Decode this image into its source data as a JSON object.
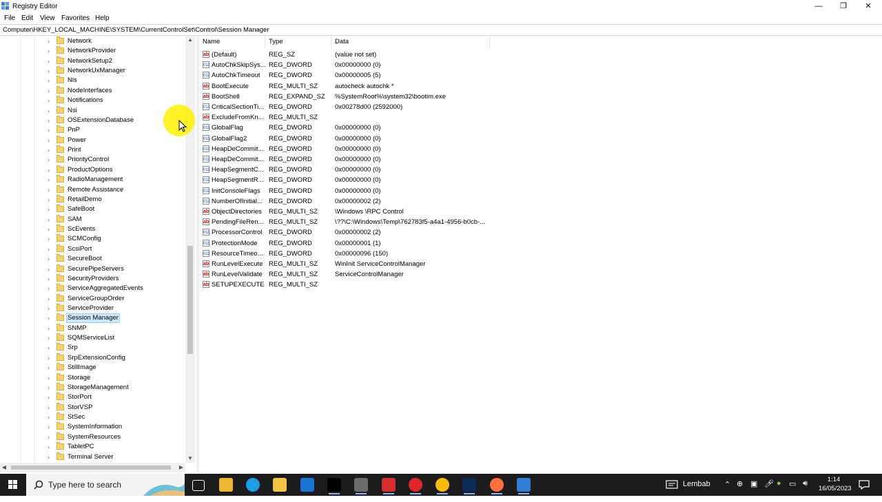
{
  "window": {
    "title": "Registry Editor",
    "controls": {
      "minimize": "—",
      "maximize": "❐",
      "close": "✕"
    }
  },
  "menu": [
    "File",
    "Edit",
    "View",
    "Favorites",
    "Help"
  ],
  "address": "Computer\\HKEY_LOCAL_MACHINE\\SYSTEM\\CurrentControlSet\\Control\\Session Manager",
  "tree": {
    "selected": "Session Manager",
    "items": [
      "Network",
      "NetworkProvider",
      "NetworkSetup2",
      "NetworkUxManager",
      "Nls",
      "NodeInterfaces",
      "Notifications",
      "Nsi",
      "OSExtensionDatabase",
      "PnP",
      "Power",
      "Print",
      "PriorityControl",
      "ProductOptions",
      "RadioManagement",
      "Remote Assistance",
      "RetailDemo",
      "SafeBoot",
      "SAM",
      "ScEvents",
      "SCMConfig",
      "ScsiPort",
      "SecureBoot",
      "SecurePipeServers",
      "SecurityProviders",
      "ServiceAggregatedEvents",
      "ServiceGroupOrder",
      "ServiceProvider",
      "Session Manager",
      "SNMP",
      "SQMServiceList",
      "Srp",
      "SrpExtensionConfig",
      "StillImage",
      "Storage",
      "StorageManagement",
      "StorPort",
      "StorVSP",
      "StSec",
      "SystemInformation",
      "SystemResources",
      "TabletPC",
      "Terminal Server"
    ]
  },
  "list": {
    "columns": [
      "Name",
      "Type",
      "Data"
    ],
    "rows": [
      {
        "icon": "string-value-icon",
        "name": "(Default)",
        "type": "REG_SZ",
        "data": "(value not set)"
      },
      {
        "icon": "binary-value-icon",
        "name": "AutoChkSkipSys...",
        "type": "REG_DWORD",
        "data": "0x00000000 (0)"
      },
      {
        "icon": "binary-value-icon",
        "name": "AutoChkTimeout",
        "type": "REG_DWORD",
        "data": "0x00000005 (5)"
      },
      {
        "icon": "string-value-icon",
        "name": "BootExecute",
        "type": "REG_MULTI_SZ",
        "data": "autocheck autochk *"
      },
      {
        "icon": "string-value-icon",
        "name": "BootShell",
        "type": "REG_EXPAND_SZ",
        "data": "%SystemRoot%\\system32\\bootim.exe"
      },
      {
        "icon": "binary-value-icon",
        "name": "CriticalSectionTi...",
        "type": "REG_DWORD",
        "data": "0x00278d00 (2592000)"
      },
      {
        "icon": "string-value-icon",
        "name": "ExcludeFromKn...",
        "type": "REG_MULTI_SZ",
        "data": ""
      },
      {
        "icon": "binary-value-icon",
        "name": "GlobalFlag",
        "type": "REG_DWORD",
        "data": "0x00000000 (0)"
      },
      {
        "icon": "binary-value-icon",
        "name": "GlobalFlag2",
        "type": "REG_DWORD",
        "data": "0x00000000 (0)"
      },
      {
        "icon": "binary-value-icon",
        "name": "HeapDeCommit...",
        "type": "REG_DWORD",
        "data": "0x00000000 (0)"
      },
      {
        "icon": "binary-value-icon",
        "name": "HeapDeCommit...",
        "type": "REG_DWORD",
        "data": "0x00000000 (0)"
      },
      {
        "icon": "binary-value-icon",
        "name": "HeapSegmentC...",
        "type": "REG_DWORD",
        "data": "0x00000000 (0)"
      },
      {
        "icon": "binary-value-icon",
        "name": "HeapSegmentR...",
        "type": "REG_DWORD",
        "data": "0x00000000 (0)"
      },
      {
        "icon": "binary-value-icon",
        "name": "InitConsoleFlags",
        "type": "REG_DWORD",
        "data": "0x00000000 (0)"
      },
      {
        "icon": "binary-value-icon",
        "name": "NumberOfInitial...",
        "type": "REG_DWORD",
        "data": "0x00000002 (2)"
      },
      {
        "icon": "string-value-icon",
        "name": "ObjectDirectories",
        "type": "REG_MULTI_SZ",
        "data": "\\Windows \\RPC Control"
      },
      {
        "icon": "string-value-icon",
        "name": "PendingFileRen...",
        "type": "REG_MULTI_SZ",
        "data": "\\??\\C:\\Windows\\Temp\\762783f5-a4a1-4956-b0cb-..."
      },
      {
        "icon": "binary-value-icon",
        "name": "ProcessorControl",
        "type": "REG_DWORD",
        "data": "0x00000002 (2)"
      },
      {
        "icon": "binary-value-icon",
        "name": "ProtectionMode",
        "type": "REG_DWORD",
        "data": "0x00000001 (1)"
      },
      {
        "icon": "binary-value-icon",
        "name": "ResourceTimeo...",
        "type": "REG_DWORD",
        "data": "0x00000096 (150)"
      },
      {
        "icon": "string-value-icon",
        "name": "RunLevelExecute",
        "type": "REG_MULTI_SZ",
        "data": "WinInit ServiceControlManager"
      },
      {
        "icon": "string-value-icon",
        "name": "RunLevelValidate",
        "type": "REG_MULTI_SZ",
        "data": "ServiceControlManager"
      },
      {
        "icon": "string-value-icon",
        "name": "SETUPEXECUTE",
        "type": "REG_MULTI_SZ",
        "data": ""
      }
    ]
  },
  "icons": {
    "string": "ab",
    "binary": "011"
  },
  "taskbar": {
    "search_placeholder": "Type here to search",
    "apps": [
      {
        "name": "task-view-icon",
        "color": "#1c1c1c"
      },
      {
        "name": "microsoft-store-icon",
        "color": "#f2b632"
      },
      {
        "name": "edge-browser-icon",
        "color": "#1ba0e1"
      },
      {
        "name": "file-explorer-icon",
        "color": "#f6c344"
      },
      {
        "name": "mail-icon",
        "color": "#1976d2"
      },
      {
        "name": "terminal-icon",
        "color": "#000000"
      },
      {
        "name": "app-icon-a",
        "color": "#6b6b6b"
      },
      {
        "name": "app-icon-b",
        "color": "#d32f2f"
      },
      {
        "name": "opera-browser-icon",
        "color": "#e0252b"
      },
      {
        "name": "chrome-browser-icon",
        "color": "#fbbc05"
      },
      {
        "name": "photoshop-icon",
        "color": "#0b2b59"
      },
      {
        "name": "firefox-browser-icon",
        "color": "#ff7139"
      },
      {
        "name": "registry-editor-icon",
        "color": "#2f7fd8"
      }
    ],
    "weather": "Lembab",
    "time": "1:14",
    "date": "16/05/2023"
  }
}
